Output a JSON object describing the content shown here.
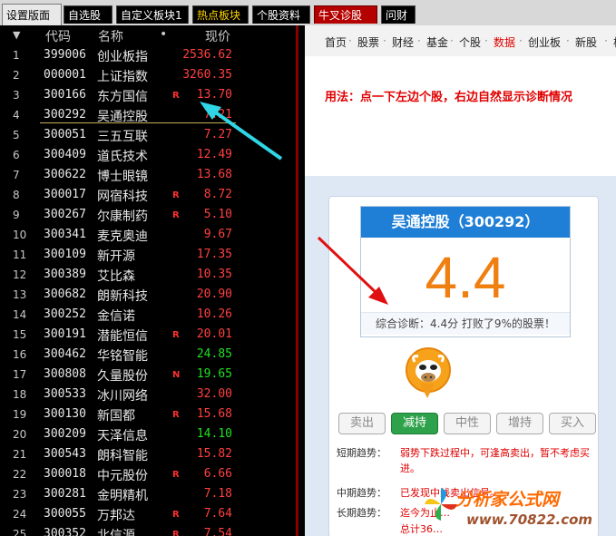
{
  "tabs": [
    {
      "label": "设置版面",
      "style": "sel"
    },
    {
      "label": "自选股",
      "style": "dark"
    },
    {
      "label": "自定义板块1",
      "style": "dark"
    },
    {
      "label": "热点板块",
      "style": "hot"
    },
    {
      "label": "个股资料",
      "style": "dark"
    },
    {
      "label": "牛叉诊股",
      "style": "red"
    },
    {
      "label": "问财",
      "style": "dark"
    }
  ],
  "stock_list": {
    "headers": {
      "sort_icon": "▼",
      "code": "代码",
      "name": "名称",
      "dot": "•",
      "price": "现价"
    },
    "rows": [
      {
        "num": "1",
        "code": "399006",
        "name": "创业板指",
        "mark": "",
        "price": "2536.62",
        "color": "#ff4040"
      },
      {
        "num": "2",
        "code": "000001",
        "name": "上证指数",
        "mark": "",
        "price": "3260.35",
        "color": "#ff4040"
      },
      {
        "num": "3",
        "code": "300166",
        "name": "东方国信",
        "mark": "R",
        "price": "13.70",
        "color": "#ff4040"
      },
      {
        "num": "4",
        "code": "300292",
        "name": "吴通控股",
        "mark": "",
        "price": "7.21",
        "color": "#ff4040"
      },
      {
        "num": "5",
        "code": "300051",
        "name": "三五互联",
        "mark": "",
        "price": "7.27",
        "color": "#ff4040"
      },
      {
        "num": "6",
        "code": "300409",
        "name": "道氏技术",
        "mark": "",
        "price": "12.49",
        "color": "#ff4040"
      },
      {
        "num": "7",
        "code": "300622",
        "name": "博士眼镜",
        "mark": "",
        "price": "13.68",
        "color": "#ff4040"
      },
      {
        "num": "8",
        "code": "300017",
        "name": "网宿科技",
        "mark": "R",
        "price": "8.72",
        "color": "#ff4040"
      },
      {
        "num": "9",
        "code": "300267",
        "name": "尔康制药",
        "mark": "R",
        "price": "5.10",
        "color": "#ff4040"
      },
      {
        "num": "10",
        "code": "300341",
        "name": "麦克奥迪",
        "mark": "",
        "price": "9.67",
        "color": "#ff4040"
      },
      {
        "num": "11",
        "code": "300109",
        "name": "新开源",
        "mark": "",
        "price": "17.35",
        "color": "#ff4040"
      },
      {
        "num": "12",
        "code": "300389",
        "name": "艾比森",
        "mark": "",
        "price": "10.35",
        "color": "#ff4040"
      },
      {
        "num": "13",
        "code": "300682",
        "name": "朗新科技",
        "mark": "",
        "price": "20.90",
        "color": "#ff4040"
      },
      {
        "num": "14",
        "code": "300252",
        "name": "金信诺",
        "mark": "",
        "price": "10.26",
        "color": "#ff4040"
      },
      {
        "num": "15",
        "code": "300191",
        "name": "潜能恒信",
        "mark": "R",
        "price": "20.01",
        "color": "#ff4040"
      },
      {
        "num": "16",
        "code": "300462",
        "name": "华铭智能",
        "mark": "",
        "price": "24.85",
        "color": "#20e020"
      },
      {
        "num": "17",
        "code": "300808",
        "name": "久量股份",
        "mark": "N",
        "price": "19.65",
        "color": "#20e020"
      },
      {
        "num": "18",
        "code": "300533",
        "name": "冰川网络",
        "mark": "",
        "price": "32.00",
        "color": "#ff4040"
      },
      {
        "num": "19",
        "code": "300130",
        "name": "新国都",
        "mark": "R",
        "price": "15.68",
        "color": "#ff4040"
      },
      {
        "num": "20",
        "code": "300209",
        "name": "天泽信息",
        "mark": "",
        "price": "14.10",
        "color": "#20e020"
      },
      {
        "num": "21",
        "code": "300543",
        "name": "朗科智能",
        "mark": "",
        "price": "15.82",
        "color": "#ff4040"
      },
      {
        "num": "22",
        "code": "300018",
        "name": "中元股份",
        "mark": "R",
        "price": "6.66",
        "color": "#ff4040"
      },
      {
        "num": "23",
        "code": "300281",
        "name": "金明精机",
        "mark": "",
        "price": "7.18",
        "color": "#ff4040"
      },
      {
        "num": "24",
        "code": "300055",
        "name": "万邦达",
        "mark": "R",
        "price": "7.64",
        "color": "#ff4040"
      },
      {
        "num": "25",
        "code": "300352",
        "name": "北信源",
        "mark": "R",
        "price": "7.54",
        "color": "#ff4040"
      }
    ]
  },
  "nav": {
    "items": [
      {
        "label": "首页",
        "color": "#222"
      },
      {
        "label": "股票",
        "color": "#222"
      },
      {
        "label": "财经",
        "color": "#222"
      },
      {
        "label": "基金",
        "color": "#222"
      },
      {
        "label": "个股",
        "color": "#222"
      },
      {
        "label": "数据",
        "color": "#e00000"
      },
      {
        "label": "创业板",
        "color": "#222"
      },
      {
        "label": "新股",
        "color": "#222"
      },
      {
        "label": "板",
        "color": "#222"
      }
    ],
    "separator": "·"
  },
  "usage_text": "用法：点一下左边个股，右边自然显示诊断情况",
  "diagnosis": {
    "title": "吴通控股（300292）",
    "score": "4.4",
    "summary": "综合诊断：4.4分 打败了9%的股票！",
    "buttons": [
      "卖出",
      "减持",
      "中性",
      "增持",
      "买入"
    ],
    "active_button": 1,
    "trends": [
      {
        "label": "短期趋势：",
        "value": "弱势下跌过程中，可逢高卖出，暂不考虑买进。"
      },
      {
        "label": "中期趋势：",
        "value": "已发现中线卖出信号。"
      },
      {
        "label": "长期趋势：",
        "value": "迄今为止…"
      },
      {
        "label": "",
        "value": "总计36…"
      }
    ]
  },
  "watermark": {
    "title": "分析家公式网",
    "url": "www.70822.com"
  },
  "colors": {
    "accent_blue": "#1f7fd6",
    "score_orange": "#f07f12",
    "down_green": "#2ea24a",
    "up_red": "#ff4040",
    "arrow_cyan": "#2fd6e6",
    "arrow_red": "#e01010"
  }
}
